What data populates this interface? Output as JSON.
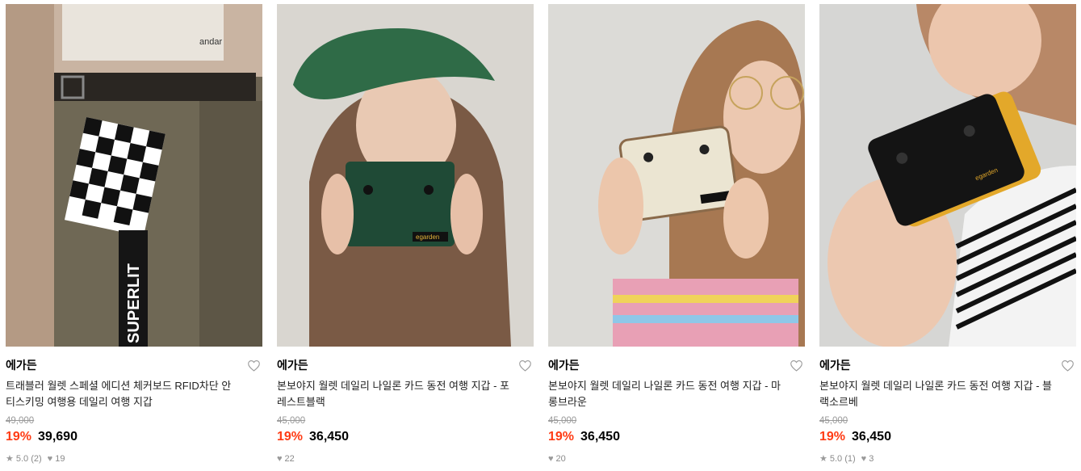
{
  "products": [
    {
      "image_alt": "",
      "brand": "에가든",
      "title": "트래블러 월렛 스페셜 에디션 체커보드 RFID차단 안티스키밍 여행용 데일리 여행 지갑",
      "original_price": "49,000",
      "discount": "19%",
      "price": "39,690",
      "rating": "5.0 (2)",
      "likes": "19",
      "icons": {
        "rating": "star-icon",
        "likes": "heart-icon",
        "wish": "heart-outline-icon"
      }
    },
    {
      "image_alt": "",
      "brand": "에가든",
      "title": "본보야지 월렛 데일리 나일론 카드 동전 여행 지갑 - 포레스트블랙",
      "original_price": "45,000",
      "discount": "19%",
      "price": "36,450",
      "rating": "",
      "likes": "22",
      "icons": {
        "likes": "heart-icon",
        "wish": "heart-outline-icon"
      }
    },
    {
      "image_alt": "",
      "brand": "에가든",
      "title": "본보야지 월렛 데일리 나일론 카드 동전 여행 지갑 - 마롱브라운",
      "original_price": "45,000",
      "discount": "19%",
      "price": "36,450",
      "rating": "",
      "likes": "20",
      "icons": {
        "likes": "heart-icon",
        "wish": "heart-outline-icon"
      }
    },
    {
      "image_alt": "",
      "brand": "에가든",
      "title": "본보야지 월렛 데일리 나일론 카드 동전 여행 지갑 - 블랙소르베",
      "original_price": "45,000",
      "discount": "19%",
      "price": "36,450",
      "rating": "5.0 (1)",
      "likes": "3",
      "icons": {
        "rating": "star-icon",
        "likes": "heart-icon",
        "wish": "heart-outline-icon"
      }
    }
  ],
  "colors": {
    "discount": "#ff3b14",
    "original_price": "#9a9a9a",
    "meta": "#8a8a8a"
  },
  "image_texts": {
    "strap_text": "SUPERLIT",
    "wallet_label": "egarden",
    "cap_text": "andar"
  }
}
